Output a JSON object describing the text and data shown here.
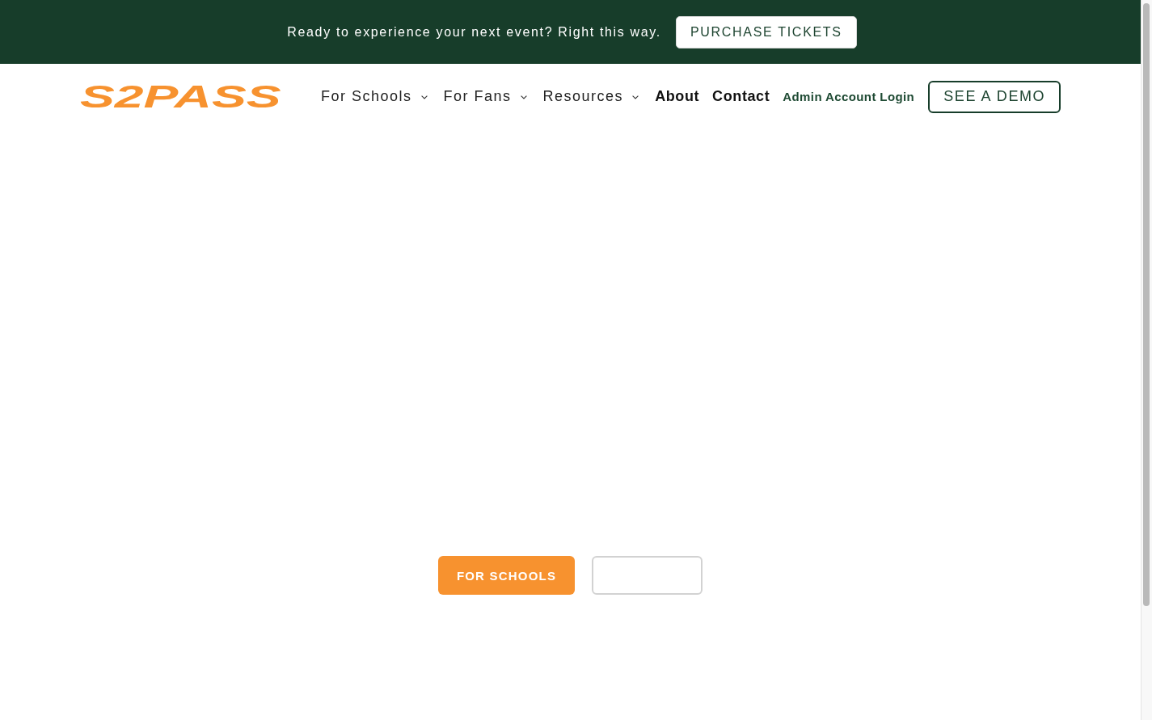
{
  "announcement_bar": {
    "text": "Ready to experience your next event? Right this way.",
    "button": "PURCHASE TICKETS"
  },
  "header": {
    "logo": "S2PASS",
    "nav": [
      {
        "label": "For Schools",
        "kind": "dropdown"
      },
      {
        "label": "For Fans",
        "kind": "dropdown"
      },
      {
        "label": "Resources",
        "kind": "dropdown"
      },
      {
        "label": "About",
        "kind": "link"
      },
      {
        "label": "Contact",
        "kind": "link"
      }
    ],
    "login_link": "Admin Account Login",
    "demo_button": "SEE A DEMO"
  },
  "hero": {
    "buttons": [
      {
        "label": "FOR SCHOOLS",
        "kind": "filled"
      },
      {
        "kind": "outline"
      }
    ]
  }
}
